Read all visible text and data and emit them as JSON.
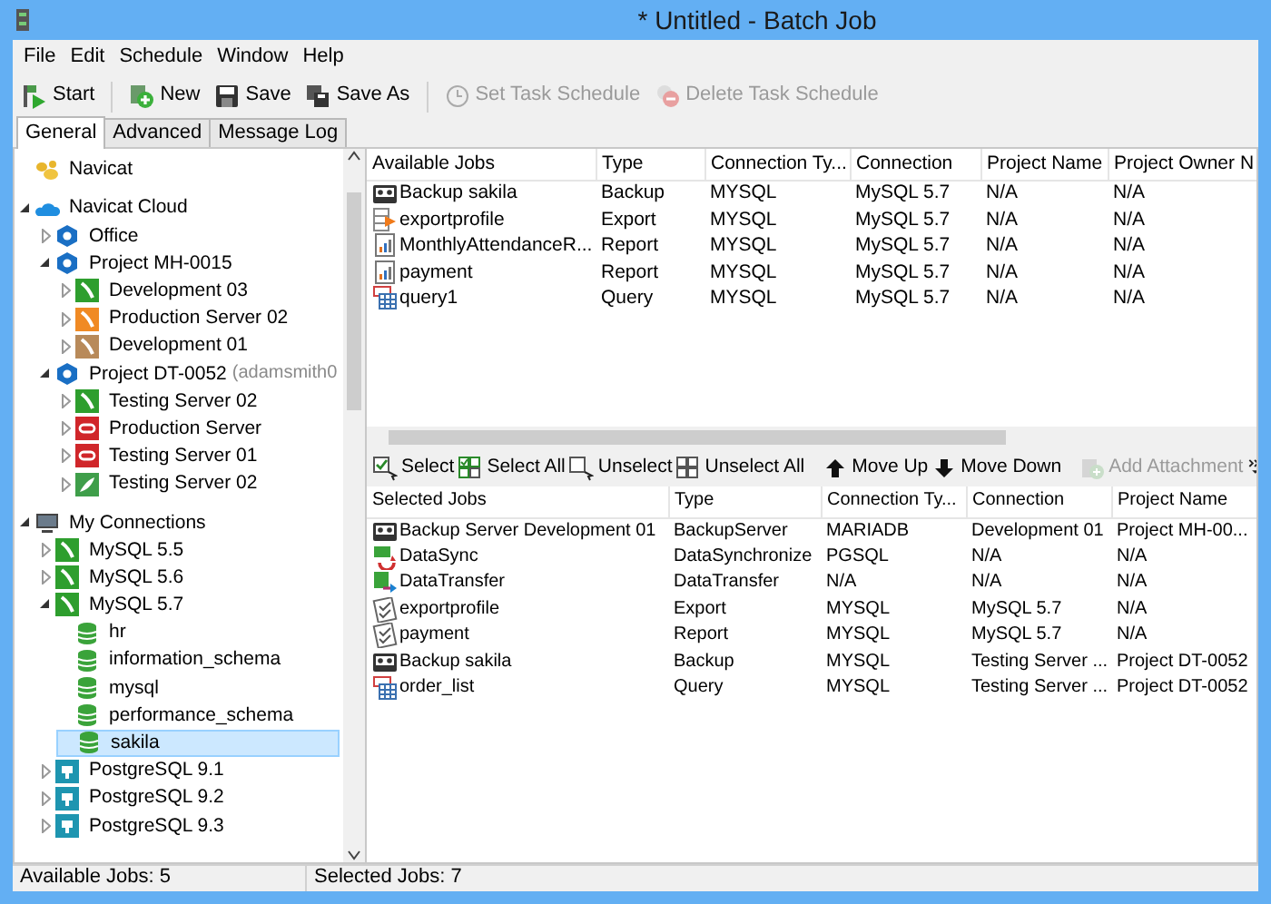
{
  "window": {
    "title": "* Untitled - Batch Job"
  },
  "menu": [
    "File",
    "Edit",
    "Schedule",
    "Window",
    "Help"
  ],
  "toolbar": [
    [
      {
        "label": "Start",
        "kind": "start",
        "disabled": false
      }
    ],
    [
      {
        "label": "New",
        "kind": "new",
        "disabled": false
      },
      {
        "label": "Save",
        "kind": "save",
        "disabled": false
      },
      {
        "label": "Save As",
        "kind": "saveas",
        "disabled": false
      }
    ],
    [
      {
        "label": "Set Task Schedule",
        "kind": "clock",
        "disabled": true
      },
      {
        "label": "Delete Task Schedule",
        "kind": "delete",
        "disabled": true
      }
    ]
  ],
  "tabs": [
    {
      "label": "General",
      "selected": true
    },
    {
      "label": "Advanced",
      "selected": false
    },
    {
      "label": "Message Log",
      "selected": false
    }
  ],
  "tree": [
    {
      "label": "Navicat",
      "kind": "app",
      "selected": false
    },
    {
      "label": "Navicat Cloud",
      "kind": "cloud",
      "expanded": true,
      "selected": false,
      "children": [
        {
          "label": "Office",
          "kind": "project",
          "expanded": false,
          "selected": false
        },
        {
          "label": "Project MH-0015",
          "kind": "project",
          "expanded": true,
          "selected": false,
          "children": [
            {
              "label": "Development 03",
              "kind": "mysql",
              "expanded": false,
              "selected": false
            },
            {
              "label": "Production Server 02",
              "kind": "mariadb",
              "expanded": false,
              "selected": false
            },
            {
              "label": "Development 01",
              "kind": "sqlite",
              "expanded": false,
              "selected": false
            }
          ]
        },
        {
          "label": "Project DT-0052",
          "note": "(adamsmith0",
          "kind": "project",
          "expanded": true,
          "selected": false,
          "children": [
            {
              "label": "Testing Server 02",
              "kind": "mysql",
              "expanded": false,
              "selected": false
            },
            {
              "label": "Production Server",
              "kind": "oracle",
              "expanded": false,
              "selected": false
            },
            {
              "label": "Testing Server 01",
              "kind": "oracle",
              "expanded": false,
              "selected": false
            },
            {
              "label": "Testing Server 02",
              "kind": "mongo",
              "expanded": false,
              "selected": false
            }
          ]
        }
      ]
    },
    {
      "label": "My Connections",
      "kind": "monitor",
      "expanded": true,
      "selected": false,
      "children": [
        {
          "label": "MySQL 5.5",
          "kind": "mysql",
          "expanded": false,
          "selected": false
        },
        {
          "label": "MySQL 5.6",
          "kind": "mysql",
          "expanded": false,
          "selected": false
        },
        {
          "label": "MySQL 5.7",
          "kind": "mysql",
          "expanded": true,
          "selected": false,
          "children": [
            {
              "label": "hr",
              "kind": "database",
              "selected": false
            },
            {
              "label": "information_schema",
              "kind": "database",
              "selected": false
            },
            {
              "label": "mysql",
              "kind": "database",
              "selected": false
            },
            {
              "label": "performance_schema",
              "kind": "database",
              "selected": false
            },
            {
              "label": "sakila",
              "kind": "database",
              "selected": true
            }
          ]
        },
        {
          "label": "PostgreSQL 9.1",
          "kind": "postgres",
          "expanded": false,
          "selected": false
        },
        {
          "label": "PostgreSQL 9.2",
          "kind": "postgres",
          "expanded": false,
          "selected": false
        },
        {
          "label": "PostgreSQL 9.3",
          "kind": "postgres",
          "expanded": false,
          "selected": false
        }
      ]
    }
  ],
  "available_jobs": {
    "columns": [
      "Available Jobs",
      "Type",
      "Connection Ty...",
      "Connection",
      "Project Name",
      "Project Owner N"
    ],
    "rows": [
      {
        "kind": "backup",
        "cells": [
          "Backup sakila",
          "Backup",
          "MYSQL",
          "MySQL 5.7",
          "N/A",
          "N/A"
        ]
      },
      {
        "kind": "export",
        "cells": [
          "exportprofile",
          "Export",
          "MYSQL",
          "MySQL 5.7",
          "N/A",
          "N/A"
        ]
      },
      {
        "kind": "report",
        "cells": [
          "MonthlyAttendanceR...",
          "Report",
          "MYSQL",
          "MySQL 5.7",
          "N/A",
          "N/A"
        ]
      },
      {
        "kind": "report",
        "cells": [
          "payment",
          "Report",
          "MYSQL",
          "MySQL 5.7",
          "N/A",
          "N/A"
        ]
      },
      {
        "kind": "query",
        "cells": [
          "query1",
          "Query",
          "MYSQL",
          "MySQL 5.7",
          "N/A",
          "N/A"
        ]
      }
    ]
  },
  "job_toolbar": [
    [
      {
        "label": "Select",
        "kind": "select",
        "disabled": false
      },
      {
        "label": "Select All",
        "kind": "selectall",
        "disabled": false
      },
      {
        "label": "Unselect",
        "kind": "unselect",
        "disabled": false
      },
      {
        "label": "Unselect All",
        "kind": "unselectall",
        "disabled": false
      }
    ],
    [
      {
        "label": "Move Up",
        "kind": "up",
        "disabled": false
      },
      {
        "label": "Move Down",
        "kind": "down",
        "disabled": false
      }
    ],
    [
      {
        "label": "Add Attachment",
        "kind": "attach",
        "disabled": true
      }
    ]
  ],
  "selected_jobs": {
    "columns": [
      "Selected Jobs",
      "Type",
      "Connection Ty...",
      "Connection",
      "Project Name"
    ],
    "rows": [
      {
        "kind": "backup",
        "cells": [
          "Backup Server Development 01",
          "BackupServer",
          "MARIADB",
          "Development 01",
          "Project MH-00..."
        ]
      },
      {
        "kind": "sync",
        "cells": [
          "DataSync",
          "DataSynchronize",
          "PGSQL",
          "N/A",
          "N/A"
        ]
      },
      {
        "kind": "transfer",
        "cells": [
          "DataTransfer",
          "DataTransfer",
          "N/A",
          "N/A",
          "N/A"
        ]
      },
      {
        "kind": "checklist",
        "cells": [
          "exportprofile",
          "Export",
          "MYSQL",
          "MySQL 5.7",
          "N/A"
        ]
      },
      {
        "kind": "checklist",
        "cells": [
          "payment",
          "Report",
          "MYSQL",
          "MySQL 5.7",
          "N/A"
        ]
      },
      {
        "kind": "backup",
        "cells": [
          "Backup sakila",
          "Backup",
          "MYSQL",
          "Testing Server ...",
          "Project DT-0052"
        ]
      },
      {
        "kind": "query",
        "cells": [
          "order_list",
          "Query",
          "MYSQL",
          "Testing Server ...",
          "Project DT-0052"
        ]
      }
    ]
  },
  "status_bar": [
    "Available Jobs: 5",
    "Selected Jobs: 7"
  ]
}
